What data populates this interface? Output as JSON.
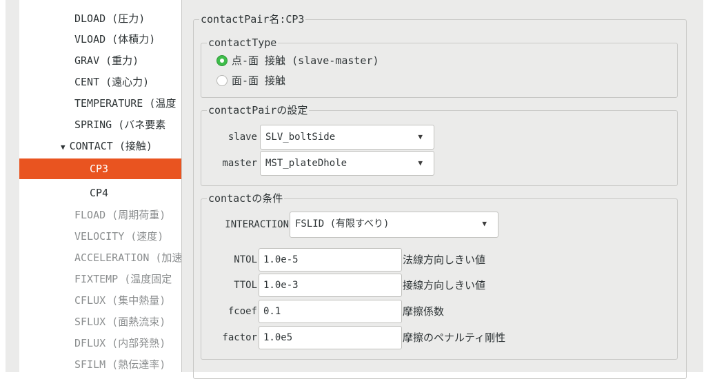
{
  "tree": {
    "items": [
      {
        "label": "DLOAD (圧力)",
        "state": "normal"
      },
      {
        "label": "VLOAD (体積力)",
        "state": "normal"
      },
      {
        "label": "GRAV (重力)",
        "state": "normal"
      },
      {
        "label": "CENT (遠心力)",
        "state": "normal"
      },
      {
        "label": "TEMPERATURE (温度",
        "state": "normal"
      },
      {
        "label": "SPRING (バネ要素",
        "state": "normal"
      },
      {
        "label": "CONTACT (接触)",
        "state": "expanded"
      },
      {
        "label": "CP3",
        "state": "selected"
      },
      {
        "label": "CP4",
        "state": "normal"
      },
      {
        "label": "FLOAD (周期荷重)",
        "state": "disabled"
      },
      {
        "label": "VELOCITY (速度)",
        "state": "disabled"
      },
      {
        "label": "ACCELERATION (加速",
        "state": "disabled"
      },
      {
        "label": "FIXTEMP (温度固定",
        "state": "disabled"
      },
      {
        "label": "CFLUX (集中熱量)",
        "state": "disabled"
      },
      {
        "label": "SFLUX (面熱流束)",
        "state": "disabled"
      },
      {
        "label": "DFLUX (内部発熱)",
        "state": "disabled"
      },
      {
        "label": "SFILM (熱伝達率)",
        "state": "disabled"
      }
    ],
    "expander_icon": "▼"
  },
  "contact_pair": {
    "title": "contactPair名:CP3",
    "contact_type": {
      "legend": "contactType",
      "options": [
        {
          "label": "点-面 接触 (slave-master)",
          "checked": true
        },
        {
          "label": "面-面 接触",
          "checked": false
        }
      ]
    },
    "pair_settings": {
      "legend": "contactPairの設定",
      "slave_label": "slave",
      "slave_value": "SLV_boltSide",
      "master_label": "master",
      "master_value": "MST_plateDhole"
    },
    "conditions": {
      "legend": "contactの条件",
      "interaction_label": "INTERACTION",
      "interaction_value": "FSLID (有限すべり)",
      "params": [
        {
          "label": "NTOL",
          "value": "1.0e-5",
          "desc": "法線方向しきい値"
        },
        {
          "label": "TTOL",
          "value": "1.0e-3",
          "desc": "接線方向しきい値"
        },
        {
          "label": "fcoef",
          "value": "0.1",
          "desc": "摩擦係数"
        },
        {
          "label": "factor",
          "value": "1.0e5",
          "desc": "摩擦のペナルティ剛性"
        }
      ]
    },
    "dropdown_icon": "▼"
  },
  "colors": {
    "selected": "#e95420",
    "radio_checked": "#3ebd4a"
  }
}
